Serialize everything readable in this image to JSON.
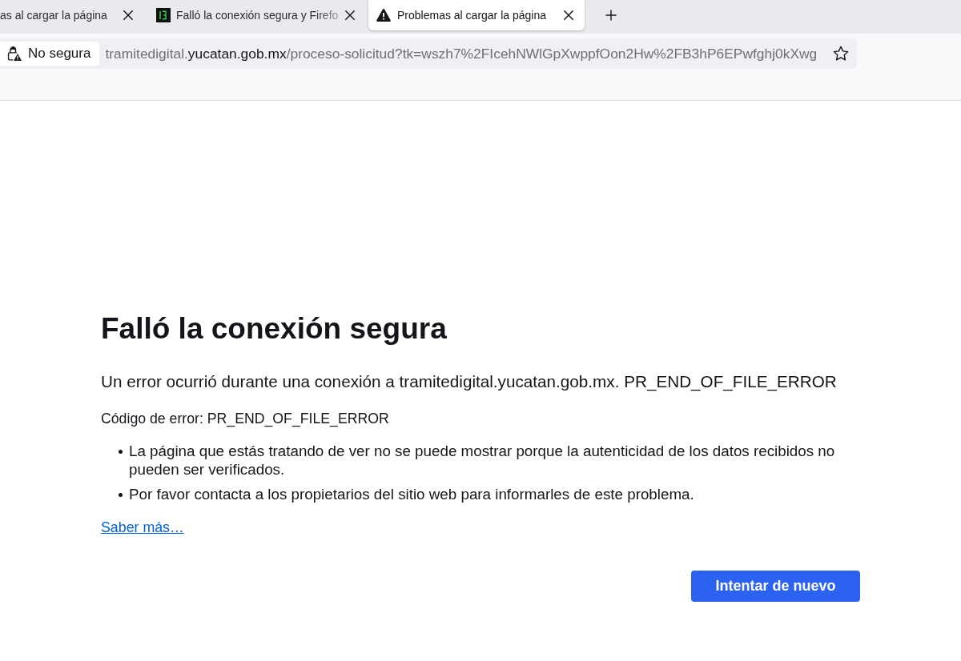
{
  "tabs": [
    {
      "kind": "clipped",
      "title": "as al cargar la página",
      "selected": false
    },
    {
      "kind": "site",
      "title": "Falló la conexión segura y Firefo",
      "selected": false
    },
    {
      "kind": "error",
      "title": "Problemas al cargar la página",
      "selected": true
    }
  ],
  "address_bar": {
    "identity_label": "No segura",
    "url": {
      "subdomain": "tramitedigital.",
      "domain": "yucatan.gob.mx",
      "path": "/proceso-solicitud?tk=wszh7%2FIcehNWlGpXwppfOon2Hw%2FB3hP6EPwfghj0kXwg"
    }
  },
  "error_page": {
    "title": "Falló la conexión segura",
    "description": "Un error ocurrió durante una conexión a tramitedigital.yucatan.gob.mx. PR_END_OF_FILE_ERROR",
    "error_code": "Código de error: PR_END_OF_FILE_ERROR",
    "items": [
      "La página que estás tratando de ver no se puede mostrar porque la autenticidad de los datos recibidos no pueden ser verificados.",
      "Por favor contacta a los propietarios del sitio web para informarles de este problema."
    ],
    "learn_more_link": "Saber más…",
    "retry_button": "Intentar de nuevo"
  }
}
